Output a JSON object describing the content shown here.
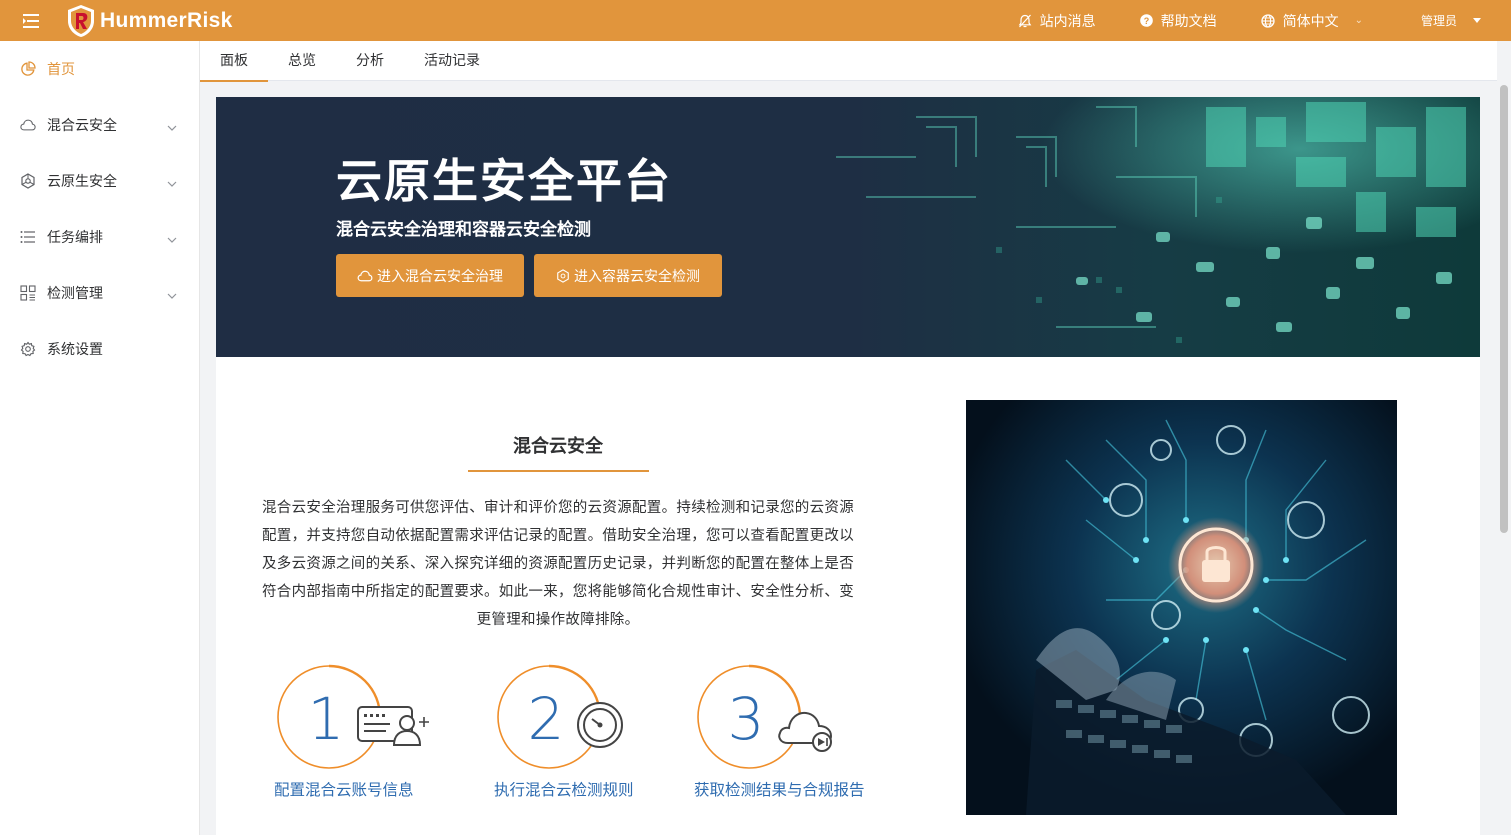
{
  "header": {
    "brand": "HummerRisk",
    "messages": "站内消息",
    "help": "帮助文档",
    "language": "简体中文",
    "user": "管理员",
    "colors": {
      "brand": "#e1953c",
      "link": "#2f6cb0"
    }
  },
  "sidebar": {
    "items": [
      {
        "label": "首页",
        "icon": "pie-chart-icon",
        "active": true
      },
      {
        "label": "混合云安全",
        "icon": "cloud-icon"
      },
      {
        "label": "云原生安全",
        "icon": "cube-network-icon"
      },
      {
        "label": "任务编排",
        "icon": "list-icon"
      },
      {
        "label": "检测管理",
        "icon": "grid-icon"
      },
      {
        "label": "系统设置",
        "icon": "gear-icon"
      }
    ]
  },
  "tabs": [
    "面板",
    "总览",
    "分析",
    "活动记录"
  ],
  "banner": {
    "title": "云原生安全平台",
    "subtitle": "混合云安全治理和容器云安全检测",
    "button1": "进入混合云安全治理",
    "button2": "进入容器云安全检测"
  },
  "section": {
    "title": "混合云安全",
    "description": "混合云安全治理服务可供您评估、审计和评价您的云资源配置。持续检测和记录您的云资源配置，并支持您自动依据配置需求评估记录的配置。借助安全治理，您可以查看配置更改以及多云资源之间的关系、深入探究详细的资源配置历史记录，并判断您的配置在整体上是否符合内部指南中所指定的配置要求。如此一来，您将能够简化合规性审计、安全性分析、变更管理和操作故障排除。",
    "steps": [
      {
        "number": "1",
        "label": "配置混合云账号信息",
        "icon": "account-card-add-icon"
      },
      {
        "number": "2",
        "label": "执行混合云检测规则",
        "icon": "timer-icon"
      },
      {
        "number": "3",
        "label": "获取检测结果与合规报告",
        "icon": "cloud-report-icon"
      }
    ]
  }
}
